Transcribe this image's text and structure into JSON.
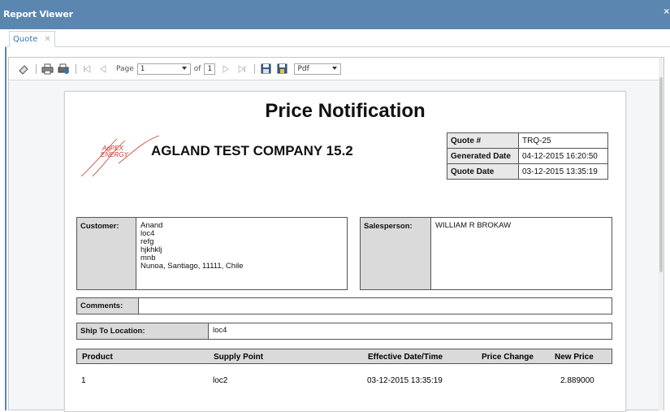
{
  "window": {
    "title": "Report Viewer",
    "close_glyph": "×"
  },
  "tabs": [
    {
      "label": "Quote",
      "close_glyph": "✕"
    }
  ],
  "toolbar": {
    "page_label": "Page",
    "page_value": "1",
    "of_label": "of",
    "total_pages": "1",
    "export_format": "Pdf",
    "icons": [
      "eraser-icon",
      "print-icon",
      "print-preview-icon",
      "first-page-icon",
      "previous-page-icon",
      "next-page-icon",
      "last-page-icon",
      "save-icon",
      "export-icon"
    ]
  },
  "report": {
    "title": "Price Notification",
    "company": "AGLAND TEST COMPANY 15.2",
    "logo_text": {
      "line1": "AgPEX",
      "line2": "ENERGY"
    },
    "quote": [
      {
        "label": "Quote #",
        "value": "TRQ-25"
      },
      {
        "label": "Generated Date",
        "value": "04-12-2015 16:20:50"
      },
      {
        "label": "Quote Date",
        "value": "03-12-2015 13:35:19"
      }
    ],
    "customer": {
      "label": "Customer:",
      "lines": [
        "Anand",
        "loc4",
        "refg",
        "hjkhklj",
        "mnb",
        "Nunoa, Santiago, 11111, Chile"
      ]
    },
    "salesperson": {
      "label": "Salesperson:",
      "value": "WILLIAM R BROKAW"
    },
    "comments": {
      "label": "Comments:",
      "value": ""
    },
    "ship_to": {
      "label": "Ship To Location:",
      "value": "loc4"
    },
    "products": {
      "columns": [
        "Product",
        "Supply Point",
        "Effective Date/Time",
        "Price Change",
        "New Price"
      ],
      "rows": [
        [
          "1",
          "loc2",
          "03-12-2015 13:35:19",
          "",
          "2.889000"
        ]
      ]
    }
  },
  "colors": {
    "titlebar": "#5b86b0",
    "tab_text": "#3b73a6",
    "logo": "#c0392b"
  }
}
